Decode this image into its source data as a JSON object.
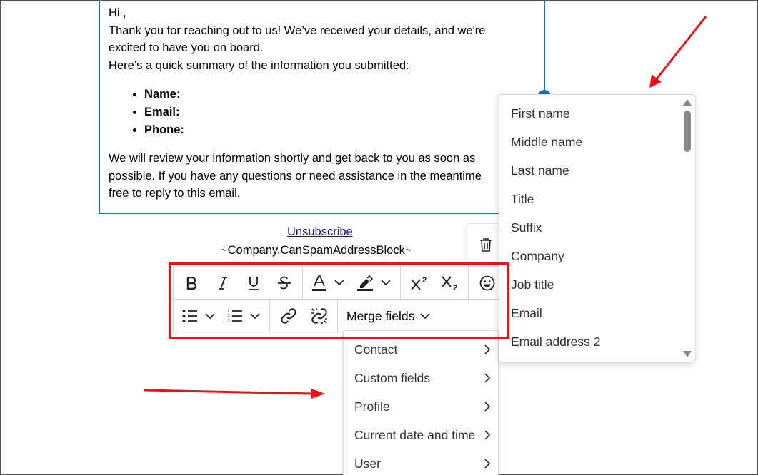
{
  "email": {
    "greeting": "Hi ,",
    "line1": "Thank you for reaching out to us! We’ve received your details, and we're",
    "line2": "excited to have you on board.",
    "line3": "Here’s a quick summary of the information you submitted:",
    "bullets": [
      "Name:",
      "Email:",
      "Phone:"
    ],
    "para1": "We will review your information shortly and get back to you as soon as",
    "para2": "possible. If you have any questions or need assistance in the meantime",
    "para3": "free to reply to this email."
  },
  "footer": {
    "unsubscribe": "Unsubscribe",
    "address_block": "~Company.CanSpamAddressBlock~"
  },
  "toolbar": {
    "merge_fields_label": "Merge fields",
    "buttons": [
      "bold",
      "italic",
      "underline",
      "strikethrough",
      "font-color",
      "highlight-color",
      "superscript",
      "subscript",
      "emoji",
      "bullet-list",
      "numbered-list",
      "link",
      "unlink"
    ]
  },
  "merge_menu": {
    "items": [
      "Contact",
      "Custom fields",
      "Profile",
      "Current date and time",
      "User"
    ]
  },
  "contact_submenu": {
    "items": [
      "First name",
      "Middle name",
      "Last name",
      "Title",
      "Suffix",
      "Company",
      "Job title",
      "Email",
      "Email address 2"
    ]
  },
  "colors": {
    "accent": "#1f6fb5",
    "annotation": "#e8141c",
    "link": "#1a0dab"
  }
}
